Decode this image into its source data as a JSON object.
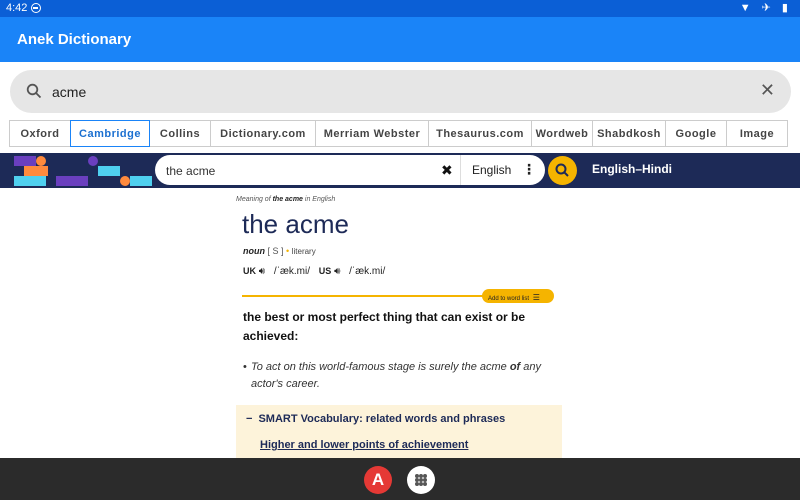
{
  "status": {
    "time": "4:42",
    "icons": "▼ ✈ ▮"
  },
  "app": {
    "title": "Anek Dictionary"
  },
  "search": {
    "value": "acme"
  },
  "tabs": [
    {
      "label": "Oxford",
      "active": false
    },
    {
      "label": "Cambridge",
      "active": true
    },
    {
      "label": "Collins",
      "active": false
    },
    {
      "label": "Dictionary.com",
      "active": false
    },
    {
      "label": "Merriam Webster",
      "active": false
    },
    {
      "label": "Thesaurus.com",
      "active": false
    },
    {
      "label": "Wordweb",
      "active": false
    },
    {
      "label": "Shabdkosh",
      "active": false
    },
    {
      "label": "Google",
      "active": false
    },
    {
      "label": "Image",
      "active": false
    }
  ],
  "cambridge": {
    "search_value": "the acme",
    "language": "English",
    "dict_label": "English–Hindi"
  },
  "entry": {
    "crumb_prefix": "Meaning of ",
    "crumb_word": "the acme",
    "crumb_suffix": " in English",
    "headword": "the acme",
    "pos": "noun",
    "grammar": "[ S ]",
    "register": "literary",
    "uk_label": "UK",
    "uk_ipa": "/ˈæk.mi/",
    "us_label": "US",
    "us_ipa": "/ˈæk.mi/",
    "add_to_word_list": "Add to word list",
    "definition": "the best or most perfect thing that can exist or be achieved:",
    "example_start": "To act on this world-famous stage is surely the acme ",
    "example_bold": "of",
    "example_end": " any actor's career.",
    "smart_vocab_title": "SMART Vocabulary: related words and phrases",
    "smart_vocab_link": "Higher and lower points of achievement"
  },
  "nav": {
    "app_letter": "A"
  },
  "colors": {
    "appbar": "#1a84f8",
    "cambridge_navy": "#1d2a57",
    "cambridge_yellow": "#f5b400"
  }
}
